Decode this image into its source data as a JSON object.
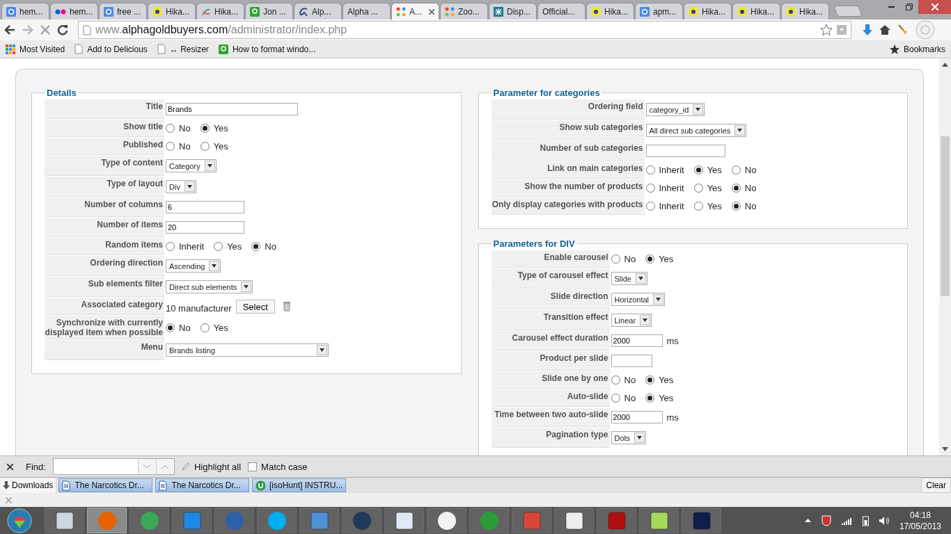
{
  "tabs": [
    {
      "label": "hem...",
      "selected": false
    },
    {
      "label": "hem...",
      "selected": false
    },
    {
      "label": "free ...",
      "selected": false
    },
    {
      "label": "Hika...",
      "selected": false
    },
    {
      "label": "Hika...",
      "selected": false
    },
    {
      "label": "Jon ...",
      "selected": false
    },
    {
      "label": "Alp...",
      "selected": false
    },
    {
      "label": "Alpha ...",
      "selected": false
    },
    {
      "label": "A...",
      "selected": true
    },
    {
      "label": "Zoo...",
      "selected": false
    },
    {
      "label": "Disp...",
      "selected": false
    },
    {
      "label": "Official...",
      "selected": false
    },
    {
      "label": "Hika...",
      "selected": false
    },
    {
      "label": "apm...",
      "selected": false
    },
    {
      "label": "Hika...",
      "selected": false
    },
    {
      "label": "Hika...",
      "selected": false
    },
    {
      "label": "Hika...",
      "selected": false
    }
  ],
  "address": {
    "prefix": "www.",
    "domain": "alphagoldbuyers.com",
    "path": "/administrator/index.php"
  },
  "bookmarks": [
    "Most Visited",
    "Add to Delicious",
    "↔ Resizer",
    "How to format windo..."
  ],
  "bookmarks_menu": "Bookmarks",
  "panels": [
    {
      "title": "Details",
      "rows": [
        {
          "label": "Title",
          "kind": "text_wide",
          "value": "Brands"
        },
        {
          "label": "Show title",
          "kind": "radio",
          "options": [
            {
              "label": "No",
              "selected": false
            },
            {
              "label": "Yes",
              "selected": true
            }
          ]
        },
        {
          "label": "Published",
          "kind": "radio",
          "options": [
            {
              "label": "No",
              "selected": false
            },
            {
              "label": "Yes",
              "selected": false
            }
          ]
        },
        {
          "label": "Type of content",
          "kind": "select",
          "value": "Category"
        },
        {
          "label": "Type of layout",
          "kind": "select",
          "value": "Div"
        },
        {
          "label": "Number of columns",
          "kind": "text",
          "value": "6"
        },
        {
          "label": "Number of items",
          "kind": "text",
          "value": "20"
        },
        {
          "label": "Random items",
          "kind": "radio",
          "options": [
            {
              "label": "Inherit",
              "selected": false
            },
            {
              "label": "Yes",
              "selected": false
            },
            {
              "label": "No",
              "selected": true
            }
          ]
        },
        {
          "label": "Ordering direction",
          "kind": "select",
          "value": "Ascending"
        },
        {
          "label": "Sub elements filter",
          "kind": "select",
          "value": "Direct sub elements"
        },
        {
          "label": "Associated category",
          "kind": "association",
          "value": "10 manufacturer",
          "button": "Select"
        },
        {
          "label": "Synchronize with currently displayed item when possible",
          "kind": "radio",
          "options": [
            {
              "label": "No",
              "selected": true
            },
            {
              "label": "Yes",
              "selected": false
            }
          ]
        },
        {
          "label": "Menu",
          "kind": "select_wide",
          "value": "Brands listing"
        }
      ]
    },
    {
      "title": "Parameter for categories",
      "rows": [
        {
          "label": "Ordering field",
          "kind": "select",
          "value": "category_id"
        },
        {
          "label": "Show sub categories",
          "kind": "select",
          "value": "All direct sub categories"
        },
        {
          "label": "Number of sub categories",
          "kind": "text",
          "value": ""
        },
        {
          "label": "Link on main categories",
          "kind": "radio",
          "options": [
            {
              "label": "Inherit",
              "selected": false
            },
            {
              "label": "Yes",
              "selected": true
            },
            {
              "label": "No",
              "selected": false
            }
          ]
        },
        {
          "label": "Show the number of products",
          "kind": "radio",
          "options": [
            {
              "label": "Inherit",
              "selected": false
            },
            {
              "label": "Yes",
              "selected": false
            },
            {
              "label": "No",
              "selected": true
            }
          ]
        },
        {
          "label": "Only display categories with products",
          "kind": "radio",
          "options": [
            {
              "label": "Inherit",
              "selected": false
            },
            {
              "label": "Yes",
              "selected": false
            },
            {
              "label": "No",
              "selected": true
            }
          ]
        }
      ]
    },
    {
      "title": "Parameters for DIV",
      "rows": [
        {
          "label": "Enable carousel",
          "kind": "radio",
          "options": [
            {
              "label": "No",
              "selected": false
            },
            {
              "label": "Yes",
              "selected": true
            }
          ]
        },
        {
          "label": "Type of carousel effect",
          "kind": "select",
          "value": "Slide"
        },
        {
          "label": "Slide direction",
          "kind": "select",
          "value": "Horizontal"
        },
        {
          "label": "Transition effect",
          "kind": "select",
          "value": "Linear"
        },
        {
          "label": "Carousel effect duration",
          "kind": "text_unit",
          "value": "2000",
          "unit": "ms"
        },
        {
          "label": "Product per slide",
          "kind": "text_short",
          "value": ""
        },
        {
          "label": "Slide one by one",
          "kind": "radio",
          "options": [
            {
              "label": "No",
              "selected": false
            },
            {
              "label": "Yes",
              "selected": true
            }
          ]
        },
        {
          "label": "Auto-slide",
          "kind": "radio",
          "options": [
            {
              "label": "No",
              "selected": false
            },
            {
              "label": "Yes",
              "selected": true
            }
          ]
        },
        {
          "label": "Time between two auto-slide",
          "kind": "text_unit",
          "value": "2000",
          "unit": "ms"
        },
        {
          "label": "Pagination type",
          "kind": "select",
          "value": "Dots"
        }
      ]
    }
  ],
  "find_bar": {
    "label": "Find:",
    "highlight": "Highlight all",
    "match_case": {
      "label": "Match case",
      "checked": false
    }
  },
  "downloads": {
    "label": "Downloads",
    "items": [
      "The Narcotics Dr...",
      "The Narcotics Dr...",
      "[isoHunt] INSTRU..."
    ],
    "clear": "Clear"
  },
  "taskbar": {
    "apps": [
      {
        "selected": false
      },
      {
        "selected": true
      },
      {
        "selected": false
      },
      {
        "selected": false
      },
      {
        "selected": false
      },
      {
        "selected": false
      },
      {
        "selected": false
      },
      {
        "selected": false
      },
      {
        "selected": false
      },
      {
        "selected": false
      },
      {
        "selected": false
      },
      {
        "selected": false
      },
      {
        "selected": false
      },
      {
        "selected": false
      },
      {
        "selected": false
      },
      {
        "selected": false
      }
    ],
    "time": "04:18",
    "date": "17/05/2013"
  }
}
